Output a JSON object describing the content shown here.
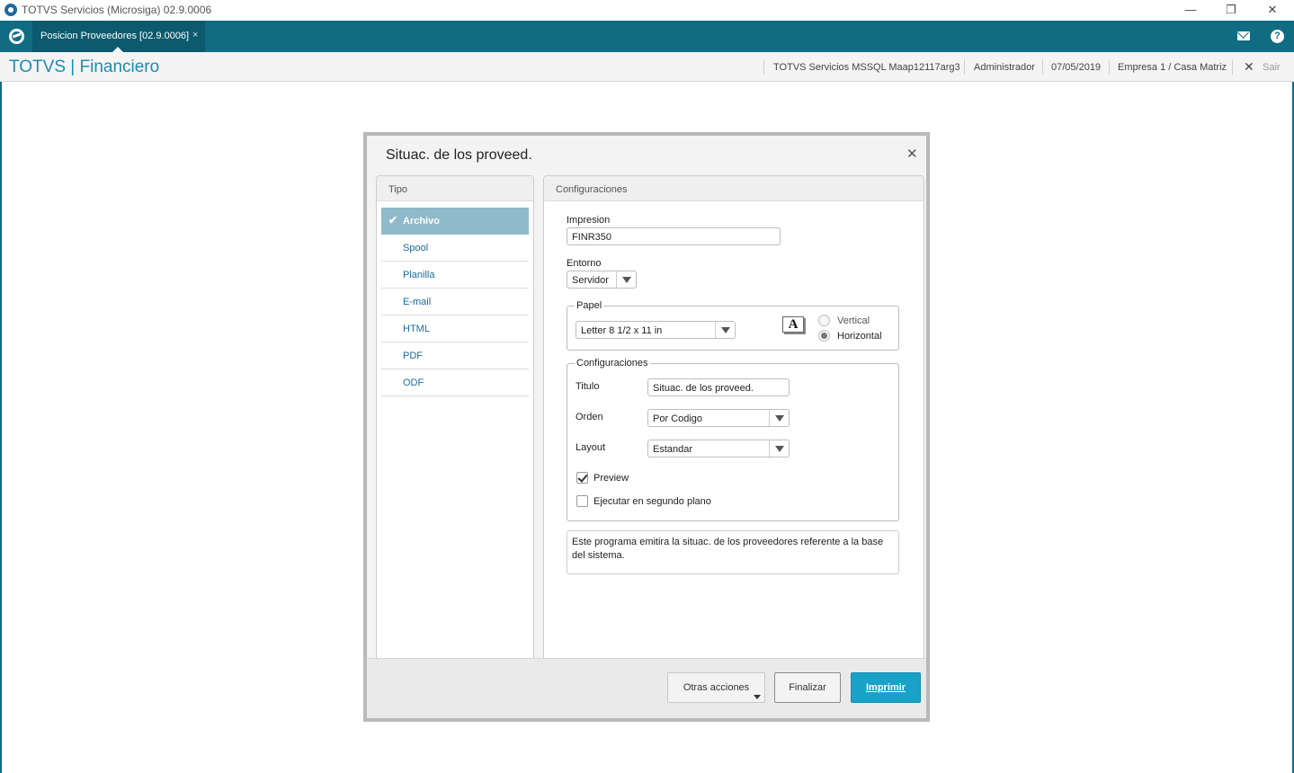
{
  "window": {
    "title": "TOTVS Servicios (Microsiga) 02.9.0006",
    "controls": {
      "minimize": "—",
      "restore": "❐",
      "close": "✕"
    }
  },
  "tabbar": {
    "tab_label": "Posicion Proveedores [02.9.0006]",
    "tab_close": "×",
    "help_glyph": "?"
  },
  "header": {
    "brand": "TOTVS | Financiero",
    "server": "TOTVS Servicios MSSQL Maap12117arg3",
    "user": "Administrador",
    "date": "07/05/2019",
    "company": "Empresa 1 / Casa Matriz",
    "exit_glyph": "✕",
    "exit_label": "Sair"
  },
  "dialog": {
    "title": "Situac. de los proveed.",
    "close_glyph": "✕",
    "tipo": {
      "heading": "Tipo",
      "check_glyph": "✔",
      "items": [
        "Archivo",
        "Spool",
        "Planilla",
        "E-mail",
        "HTML",
        "PDF",
        "ODF"
      ],
      "selected": "Archivo"
    },
    "config": {
      "heading": "Configuraciones",
      "impresion_label": "Impresion",
      "impresion_value": "FINR350",
      "entorno_label": "Entorno",
      "entorno_value": "Servidor",
      "papel": {
        "legend": "Papel",
        "size_value": "Letter 8 1/2 x 11 in",
        "font_glyph": "A",
        "vertical_label": "Vertical",
        "horizontal_label": "Horizontal",
        "orientation": "Horizontal"
      },
      "settings": {
        "legend": "Configuraciones",
        "titulo_label": "Titulo",
        "titulo_value": "Situac. de los proveed.",
        "orden_label": "Orden",
        "orden_value": "Por Codigo",
        "layout_label": "Layout",
        "layout_value": "Estandar",
        "preview_label": "Preview",
        "preview_checked": true,
        "background_label": "Ejecutar en segundo plano",
        "background_checked": false
      },
      "description": "Este programa emitira la situac. de los proveedores referente a la base del sistema."
    },
    "buttons": {
      "other": "Otras acciones",
      "finish": "Finalizar",
      "print": "Imprimir"
    }
  },
  "colors": {
    "tabbar": "#0f6c83",
    "brand": "#1a8db3",
    "selected_item": "#8fbac9",
    "primary_button": "#1aa1c8"
  }
}
